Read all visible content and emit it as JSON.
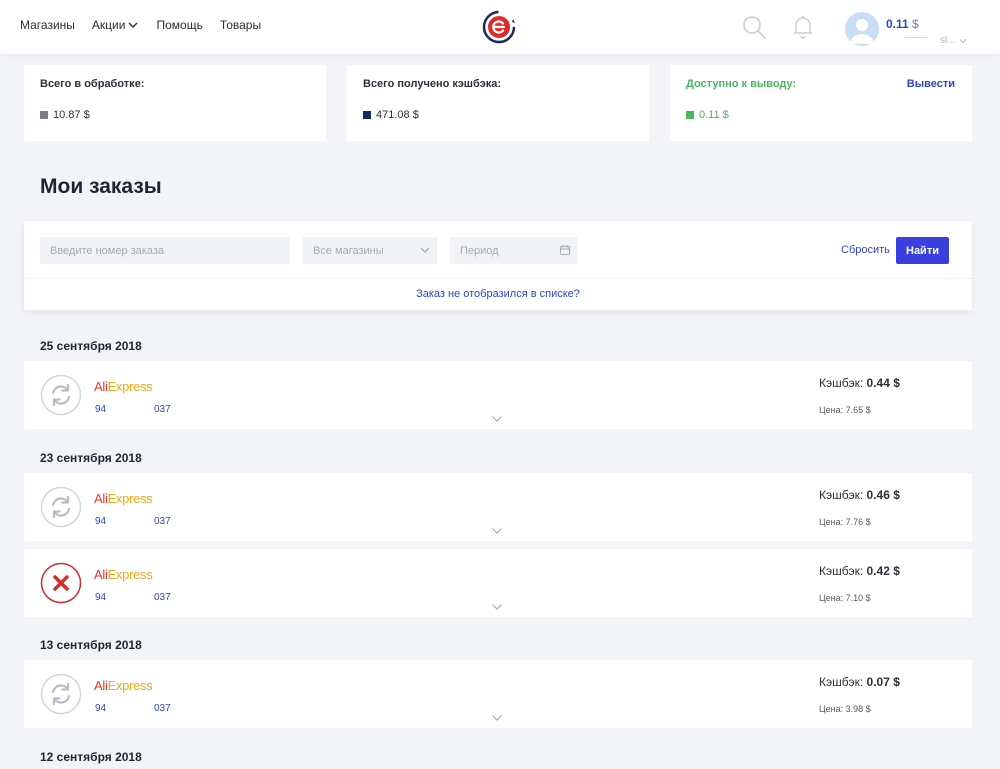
{
  "header": {
    "nav": [
      {
        "label": "Магазины"
      },
      {
        "label": "Акции"
      },
      {
        "label": "Помощь"
      },
      {
        "label": "Товары"
      }
    ],
    "balance": "0.11",
    "balance_currency": "$",
    "user_name": "sl..."
  },
  "summary": {
    "processing": {
      "label": "Всего в обработке:",
      "value": "10.87 $",
      "color": "#7b7f87"
    },
    "received": {
      "label": "Всего получено кэшбэка:",
      "value": "471.08 $",
      "color": "#1b2a5e"
    },
    "available": {
      "label": "Доступно к выводу:",
      "value": "0.11 $",
      "color": "#4bb560",
      "action": "Вывести"
    }
  },
  "page_title": "Мои заказы",
  "filter": {
    "order_placeholder": "Введите номер заказа",
    "store_select": "Все магазины",
    "period_placeholder": "Период",
    "reset": "Сбросить",
    "find": "Найти",
    "missing_link": "Заказ не отобразился в списке?"
  },
  "dates": [
    "25 сентября 2018",
    "23 сентября 2018",
    "13 сентября 2018",
    "12 сентября 2018"
  ],
  "orders": [
    {
      "status": "processing",
      "store_a": "Ali",
      "store_b": "Express",
      "id_start": "94",
      "id_end": "037",
      "cashback_label": "Кэшбэк:",
      "cashback": "0.44 $",
      "price": "Цена: 7.65 $"
    },
    {
      "status": "processing",
      "store_a": "Ali",
      "store_b": "Express",
      "id_start": "94",
      "id_end": "037",
      "cashback_label": "Кэшбэк:",
      "cashback": "0.46 $",
      "price": "Цена: 7.76 $"
    },
    {
      "status": "rejected",
      "store_a": "Ali",
      "store_b": "Express",
      "id_start": "94",
      "id_end": "037",
      "cashback_label": "Кэшбэк:",
      "cashback": "0.42 $",
      "price": "Цена: 7.10 $"
    },
    {
      "status": "processing",
      "store_a": "Ali",
      "store_b": "Express",
      "id_start": "94",
      "id_end": "037",
      "cashback_label": "Кэшбэк:",
      "cashback": "0.07 $",
      "price": "Цена: 3.98 $"
    }
  ],
  "colors": {
    "accent": "#3a3fe0",
    "link": "#2e44c9",
    "reject": "#d42b2b"
  }
}
